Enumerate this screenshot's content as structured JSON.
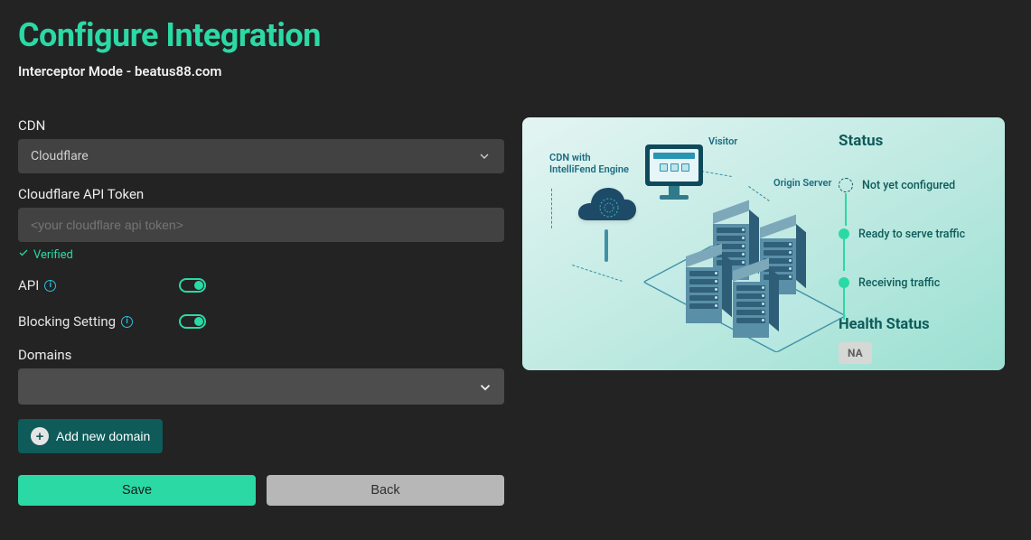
{
  "page": {
    "title": "Configure Integration",
    "subtitle": "Interceptor Mode - beatus88.com"
  },
  "form": {
    "cdn_label": "CDN",
    "cdn_value": "Cloudflare",
    "api_token_label": "Cloudflare API Token",
    "api_token_placeholder": "<your cloudflare api token>",
    "verified_text": "Verified",
    "api_label": "API",
    "api_enabled": true,
    "blocking_label": "Blocking Setting",
    "blocking_enabled": true,
    "domains_label": "Domains",
    "domains_value": "",
    "add_domain_label": "Add new domain",
    "save_label": "Save",
    "back_label": "Back"
  },
  "illustration": {
    "visitor_label": "Visitor",
    "cdn_label": "CDN with IntelliFend Engine",
    "origin_label": "Origin Server"
  },
  "status": {
    "heading": "Status",
    "steps": [
      {
        "text": "Not yet configured",
        "current": true
      },
      {
        "text": "Ready to serve traffic",
        "current": false
      },
      {
        "text": "Receiving traffic",
        "current": false
      }
    ],
    "health_heading": "Health Status",
    "health_value": "NA"
  }
}
